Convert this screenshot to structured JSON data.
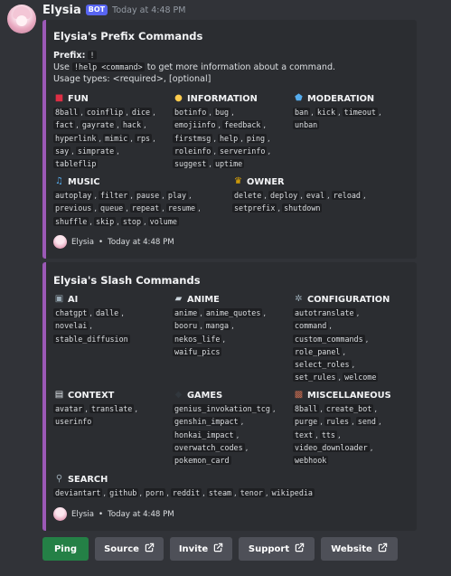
{
  "message": {
    "username": "Elysia",
    "bot_tag": "BOT",
    "timestamp": "Today at 4:48 PM"
  },
  "colors": {
    "embed_accent": "#9b59b6",
    "ping_button": "#248046",
    "secondary_button": "#4e5058"
  },
  "embed1": {
    "title": "Elysia's Prefix Commands",
    "prefix_label": "Prefix:",
    "prefix_value": "!",
    "usage_pre": "Use",
    "usage_code": "!help <command>",
    "usage_post": "to get more information about a command.",
    "usage_types": "Usage types: <required>, [optional]",
    "fields": [
      {
        "icon": "die-icon",
        "name": "FUN",
        "lines": [
          [
            "8ball",
            "coinflip",
            "dice"
          ],
          [
            "fact",
            "gayrate",
            "hack"
          ],
          [
            "hyperlink",
            "mimic",
            "rps"
          ],
          [
            "say",
            "simprate"
          ],
          [
            "tableflip"
          ]
        ]
      },
      {
        "icon": "lightbulb-icon",
        "name": "INFORMATION",
        "lines": [
          [
            "botinfo",
            "bug"
          ],
          [
            "emojiinfo",
            "feedback"
          ],
          [
            "firstmsg",
            "help",
            "ping"
          ],
          [
            "roleinfo",
            "serverinfo"
          ],
          [
            "suggest",
            "uptime"
          ]
        ]
      },
      {
        "icon": "shield-icon",
        "name": "MODERATION",
        "lines": [
          [
            "ban",
            "kick",
            "timeout"
          ],
          [
            "unban"
          ]
        ]
      },
      {
        "icon": "music-notes-icon",
        "name": "MUSIC",
        "lines": [
          [
            "autoplay",
            "filter",
            "pause",
            "play"
          ],
          [
            "previous",
            "queue",
            "repeat",
            "resume"
          ],
          [
            "shuffle",
            "skip",
            "stop",
            "volume"
          ]
        ]
      },
      {
        "icon": "crown-icon",
        "name": "OWNER",
        "lines": [
          [
            "delete",
            "deploy",
            "eval",
            "reload"
          ],
          [
            "setprefix",
            "shutdown"
          ]
        ]
      }
    ],
    "footer_name": "Elysia",
    "footer_sep": "•",
    "footer_time": "Today at 4:48 PM"
  },
  "embed2": {
    "title": "Elysia's Slash Commands",
    "fields": [
      {
        "icon": "robot-icon",
        "name": "AI",
        "lines": [
          [
            "chatgpt",
            "dalle"
          ],
          [
            "novelai"
          ],
          [
            "stable_diffusion"
          ]
        ]
      },
      {
        "icon": "clapper-icon",
        "name": "ANIME",
        "lines": [
          [
            "anime",
            "anime_quotes"
          ],
          [
            "booru",
            "manga"
          ],
          [
            "nekos_life"
          ],
          [
            "waifu_pics"
          ]
        ]
      },
      {
        "icon": "gear-icon",
        "name": "CONFIGURATION",
        "lines": [
          [
            "autotranslate"
          ],
          [
            "command"
          ],
          [
            "custom_commands"
          ],
          [
            "role_panel"
          ],
          [
            "select_roles"
          ],
          [
            "set_rules",
            "welcome"
          ]
        ]
      },
      {
        "icon": "document-icon",
        "name": "CONTEXT",
        "lines": [
          [
            "avatar",
            "translate"
          ],
          [
            "userinfo"
          ]
        ]
      },
      {
        "icon": "gamepad-icon",
        "name": "GAMES",
        "lines": [
          [
            "genius_invokation_tcg"
          ],
          [
            "genshin_impact"
          ],
          [
            "honkai_impact"
          ],
          [
            "overwatch_codes"
          ],
          [
            "pokemon_card"
          ]
        ]
      },
      {
        "icon": "package-icon",
        "name": "MISCELLANEOUS",
        "lines": [
          [
            "8ball",
            "create_bot"
          ],
          [
            "purge",
            "rules",
            "send"
          ],
          [
            "text",
            "tts"
          ],
          [
            "video_downloader"
          ],
          [
            "webhook"
          ]
        ]
      },
      {
        "icon": "magnifier-icon",
        "name": "SEARCH",
        "lines": [
          [
            "deviantart",
            "github",
            "porn",
            "reddit",
            "steam",
            "tenor",
            "wikipedia"
          ]
        ]
      }
    ],
    "footer_name": "Elysia",
    "footer_sep": "•",
    "footer_time": "Today at 4:48 PM"
  },
  "buttons": [
    {
      "label": "Ping",
      "style": "primary",
      "external": false
    },
    {
      "label": "Source",
      "style": "secondary",
      "external": true
    },
    {
      "label": "Invite",
      "style": "secondary",
      "external": true
    },
    {
      "label": "Support",
      "style": "secondary",
      "external": true
    },
    {
      "label": "Website",
      "style": "secondary",
      "external": true
    }
  ]
}
